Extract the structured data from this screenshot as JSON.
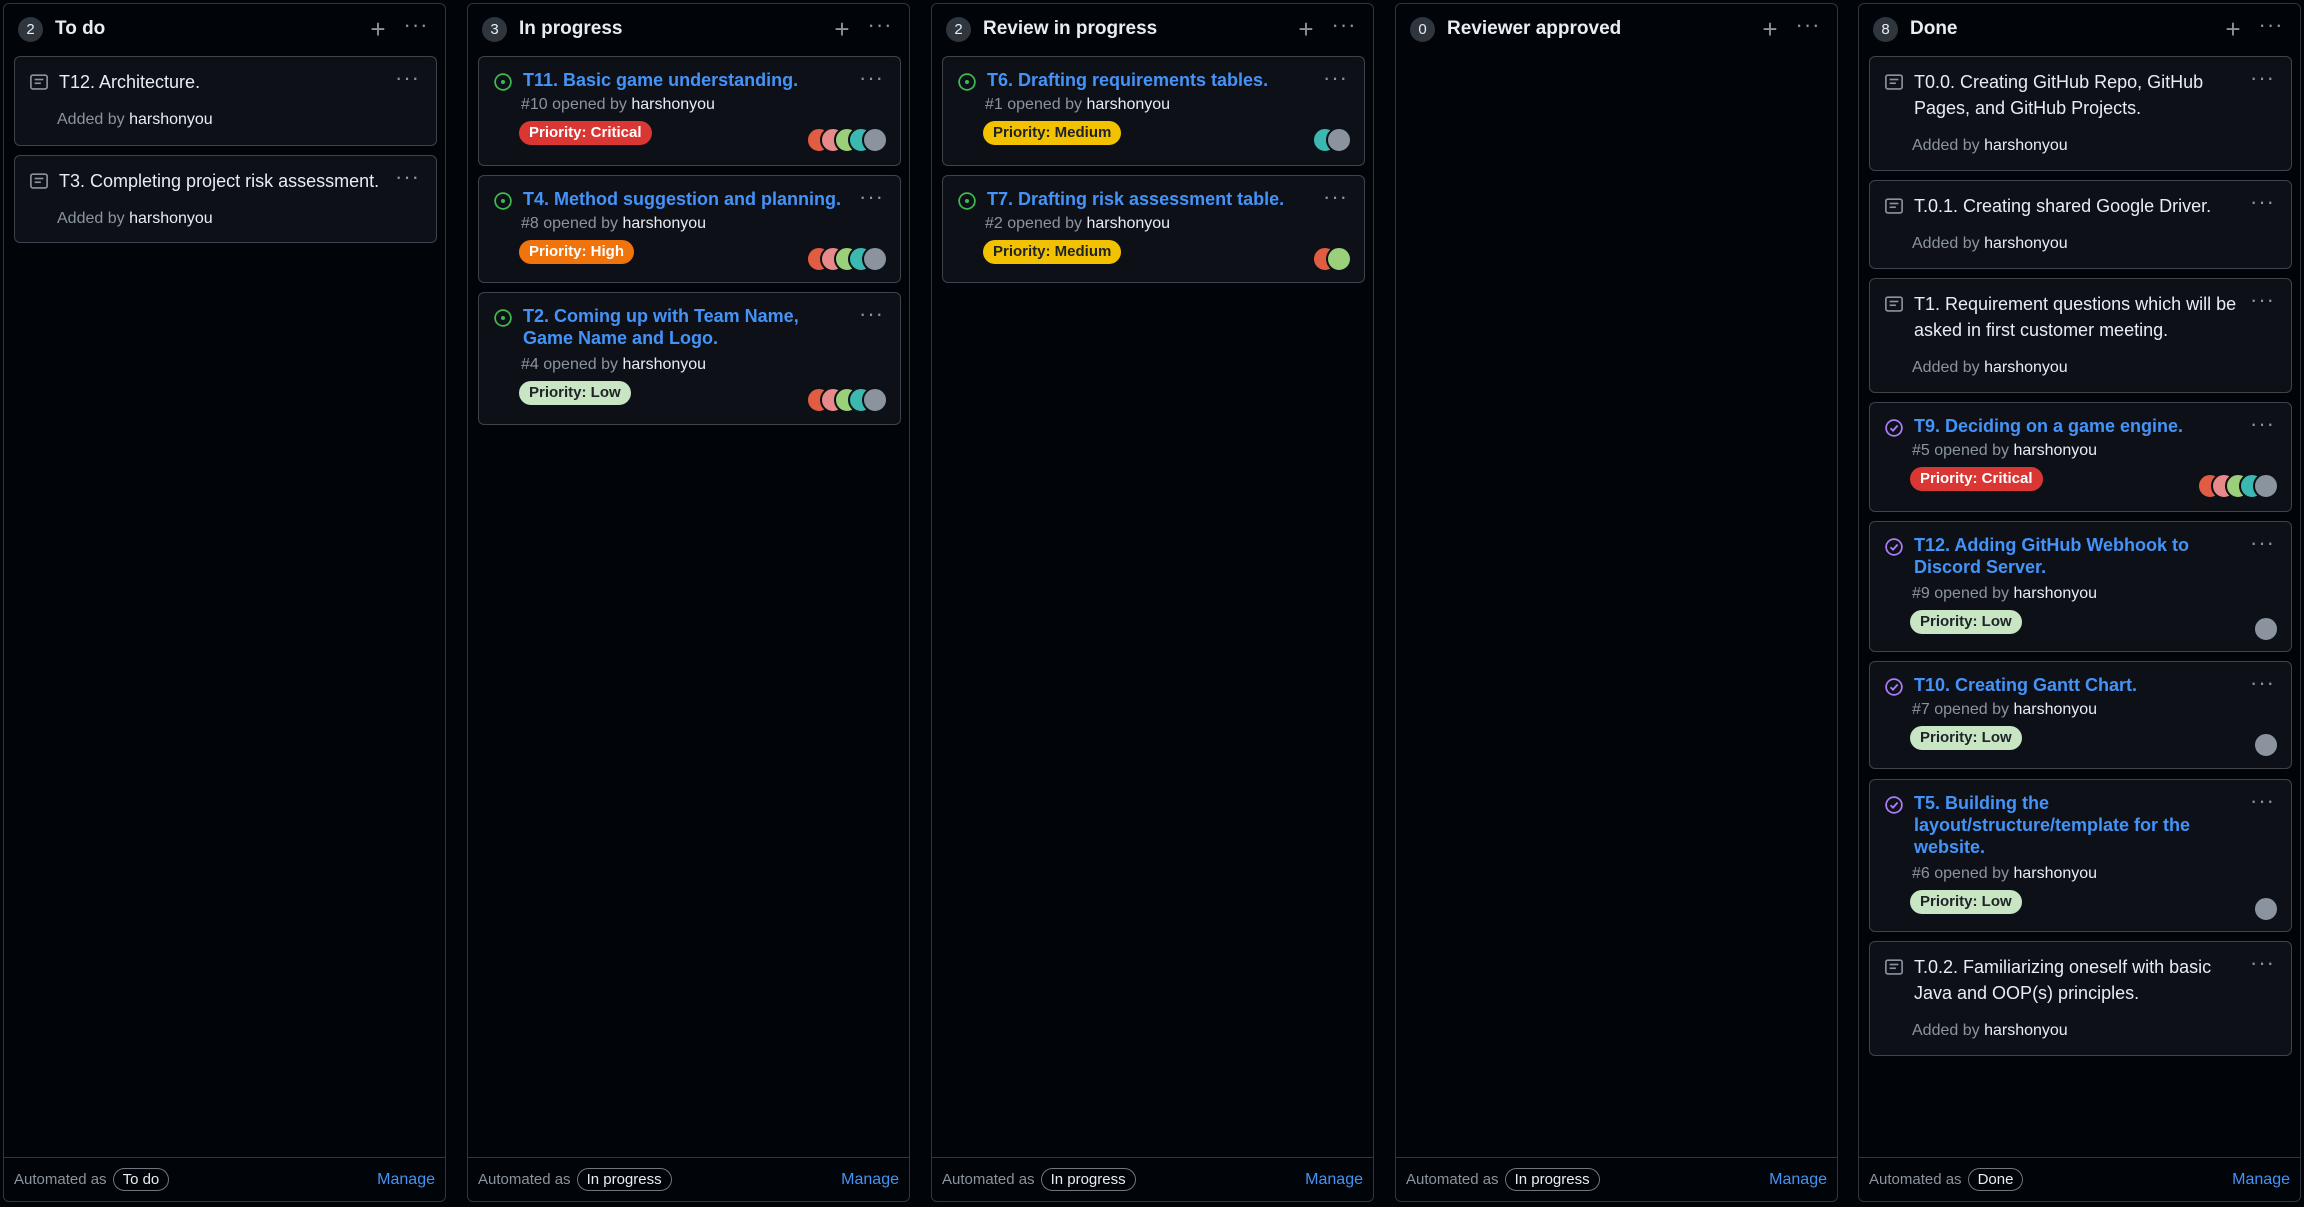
{
  "colors": {
    "priority_critical": "#da3633",
    "priority_high": "#f0730c",
    "priority_medium": "#f2c200",
    "priority_low": "#c8e6c4",
    "link": "#4493f8",
    "open_issue": "#3fb950",
    "closed_issue": "#ab7df8"
  },
  "ui": {
    "add_icon": "+",
    "more_icon": "···",
    "automated_label": "Automated as",
    "manage_label": "Manage"
  },
  "columns": [
    {
      "count": "2",
      "title": "To do",
      "automation": "To do",
      "cards": [
        {
          "type": "note",
          "text": "T12. Architecture.",
          "added_prefix": "Added by",
          "user": "harshonyou"
        },
        {
          "type": "note",
          "text": "T3. Completing project risk assessment.",
          "added_prefix": "Added by",
          "user": "harshonyou"
        }
      ]
    },
    {
      "count": "3",
      "title": "In progress",
      "automation": "In progress",
      "cards": [
        {
          "type": "issue",
          "state": "open",
          "title": "T11. Basic game understanding.",
          "ref": "#10 opened by",
          "user": "harshonyou",
          "label": "Priority: Critical",
          "avatars": [
            "red",
            "pink",
            "green",
            "teal",
            "gray"
          ]
        },
        {
          "type": "issue",
          "state": "open",
          "title": "T4. Method suggestion and planning.",
          "ref": "#8 opened by",
          "user": "harshonyou",
          "label": "Priority: High",
          "avatars": [
            "red",
            "pink",
            "green",
            "teal",
            "gray"
          ]
        },
        {
          "type": "issue",
          "state": "open",
          "title": "T2. Coming up with Team Name, Game Name and Logo.",
          "ref": "#4 opened by",
          "user": "harshonyou",
          "label": "Priority: Low",
          "avatars": [
            "red",
            "pink",
            "green",
            "teal",
            "gray"
          ]
        }
      ]
    },
    {
      "count": "2",
      "title": "Review in progress",
      "automation": "In progress",
      "cards": [
        {
          "type": "issue",
          "state": "open",
          "title": "T6. Drafting requirements tables.",
          "ref": "#1 opened by",
          "user": "harshonyou",
          "label": "Priority: Medium",
          "avatars": [
            "teal",
            "gray"
          ]
        },
        {
          "type": "issue",
          "state": "open",
          "title": "T7. Drafting risk assessment table.",
          "ref": "#2 opened by",
          "user": "harshonyou",
          "label": "Priority: Medium",
          "avatars": [
            "red",
            "green"
          ]
        }
      ]
    },
    {
      "count": "0",
      "title": "Reviewer approved",
      "automation": "In progress",
      "cards": []
    },
    {
      "count": "8",
      "title": "Done",
      "automation": "Done",
      "cards": [
        {
          "type": "note",
          "text": "T0.0. Creating GitHub Repo, GitHub Pages, and GitHub Projects.",
          "added_prefix": "Added by",
          "user": "harshonyou"
        },
        {
          "type": "note",
          "text": "T.0.1. Creating shared Google Driver.",
          "added_prefix": "Added by",
          "user": "harshonyou"
        },
        {
          "type": "note",
          "text": "T1. Requirement questions which will be asked in first customer meeting.",
          "added_prefix": "Added by",
          "user": "harshonyou"
        },
        {
          "type": "issue",
          "state": "closed",
          "title": "T9. Deciding on a game engine.",
          "ref": "#5 opened by",
          "user": "harshonyou",
          "label": "Priority: Critical",
          "avatars": [
            "red",
            "pink",
            "green",
            "teal",
            "gray"
          ]
        },
        {
          "type": "issue",
          "state": "closed",
          "title": "T12. Adding GitHub Webhook to Discord Server.",
          "ref": "#9 opened by",
          "user": "harshonyou",
          "label": "Priority: Low",
          "avatars": [
            "gray"
          ]
        },
        {
          "type": "issue",
          "state": "closed",
          "title": "T10. Creating Gantt Chart.",
          "ref": "#7 opened by",
          "user": "harshonyou",
          "label": "Priority: Low",
          "avatars": [
            "gray"
          ]
        },
        {
          "type": "issue",
          "state": "closed",
          "title": "T5. Building the layout/structure/template for the website.",
          "ref": "#6 opened by",
          "user": "harshonyou",
          "label": "Priority: Low",
          "avatars": [
            "gray"
          ]
        },
        {
          "type": "note",
          "text": "T.0.2. Familiarizing oneself with basic Java and OOP(s) principles.",
          "added_prefix": "Added by",
          "user": "harshonyou"
        }
      ]
    }
  ]
}
